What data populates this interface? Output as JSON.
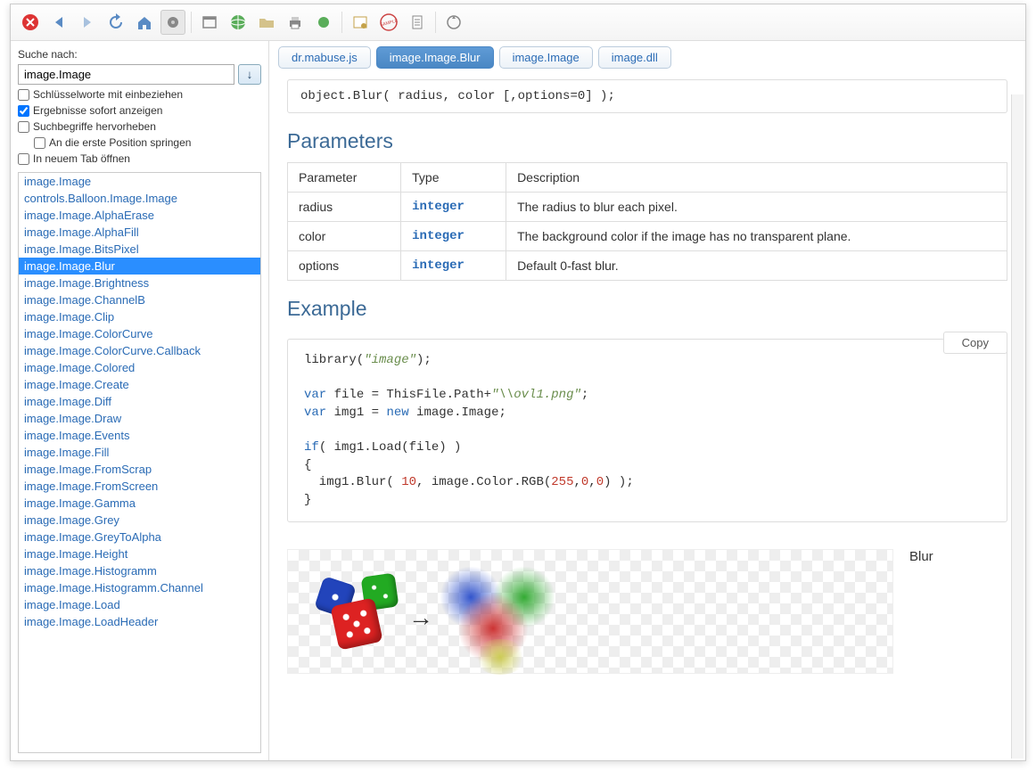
{
  "toolbar": {
    "icons": [
      "close",
      "back",
      "forward",
      "refresh",
      "home",
      "tools",
      "new-window",
      "globe",
      "folder",
      "print",
      "globe-small",
      "certificate",
      "sample",
      "document",
      "reload"
    ]
  },
  "sidebar": {
    "search_label": "Suche nach:",
    "search_value": "image.Image",
    "search_button_title": "↓",
    "cb_keywords": "Schlüsselworte mit einbeziehen",
    "cb_keywords_checked": false,
    "cb_instant": "Ergebnisse sofort anzeigen",
    "cb_instant_checked": true,
    "cb_highlight": "Suchbegriffe hervorheben",
    "cb_highlight_checked": false,
    "cb_firstpos": "An die erste Position springen",
    "cb_firstpos_checked": false,
    "cb_newtab": "In neuem Tab öffnen",
    "cb_newtab_checked": false,
    "results": [
      "image.Image",
      "controls.Balloon.Image.Image",
      "image.Image.AlphaErase",
      "image.Image.AlphaFill",
      "image.Image.BitsPixel",
      "image.Image.Blur",
      "image.Image.Brightness",
      "image.Image.ChannelB",
      "image.Image.Clip",
      "image.Image.ColorCurve",
      "image.Image.ColorCurve.Callback",
      "image.Image.Colored",
      "image.Image.Create",
      "image.Image.Diff",
      "image.Image.Draw",
      "image.Image.Events",
      "image.Image.Fill",
      "image.Image.FromScrap",
      "image.Image.FromScreen",
      "image.Image.Gamma",
      "image.Image.Grey",
      "image.Image.GreyToAlpha",
      "image.Image.Height",
      "image.Image.Histogramm",
      "image.Image.Histogramm.Channel",
      "image.Image.Load",
      "image.Image.LoadHeader"
    ],
    "selected_index": 5
  },
  "tabs": [
    {
      "label": "dr.mabuse.js",
      "active": false
    },
    {
      "label": "image.Image.Blur",
      "active": true
    },
    {
      "label": "image.Image",
      "active": false
    },
    {
      "label": "image.dll",
      "active": false
    }
  ],
  "doc": {
    "signature": "object.Blur( radius, color [,options=0] );",
    "sec_params": "Parameters",
    "param_headers": [
      "Parameter",
      "Type",
      "Description"
    ],
    "params": [
      {
        "name": "radius",
        "type": "integer",
        "desc": "The radius to blur each pixel."
      },
      {
        "name": "color",
        "type": "integer",
        "desc": "The background color if the image has no transparent plane."
      },
      {
        "name": "options",
        "type": "integer",
        "desc": "Default 0-fast blur."
      }
    ],
    "sec_example": "Example",
    "copy_label": "Copy",
    "example_code_html": "library(<span class='kw-g'>\"image\"</span>);\n\n<span class='kw-b'>var</span> file = ThisFile.Path+<span class='kw-g'>\"\\\\ovl1.png\"</span>;\n<span class='kw-b'>var</span> img1 = <span class='kw-b'>new</span> image.Image;\n\n<span class='kw-b'>if</span>( img1.Load(file) )\n{\n  img1.Blur( <span class='kw-n'>10</span>, image.Color.RGB(<span class='kw-n'>255</span>,<span class='kw-n'>0</span>,<span class='kw-n'>0</span>) );\n}",
    "image_caption": "Blur"
  }
}
